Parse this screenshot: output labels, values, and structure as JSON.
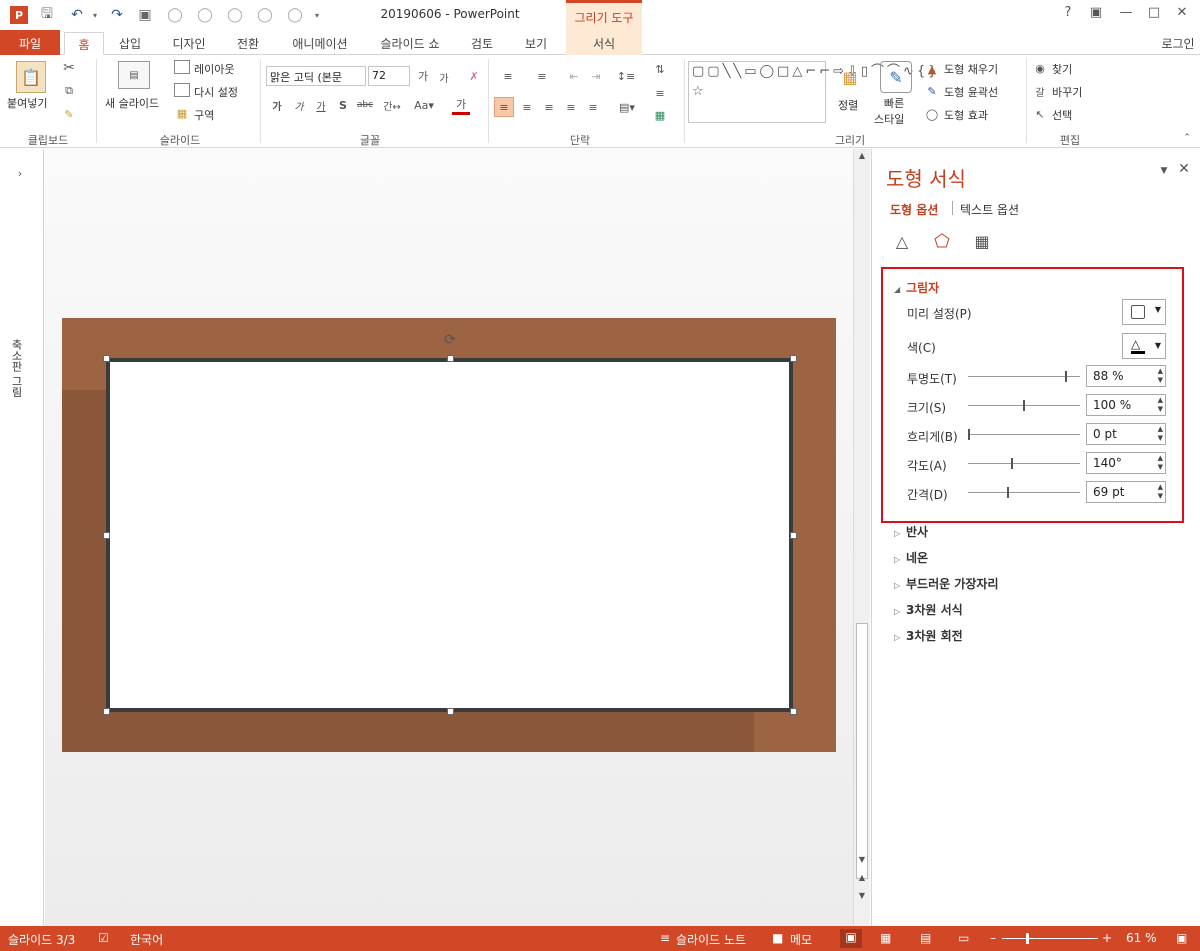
{
  "window": {
    "title": "20190606 - PowerPoint",
    "tools_label": "그리기 도구",
    "help": "?",
    "login": "로그인"
  },
  "tabs": {
    "file": "파일",
    "home": "홈",
    "insert": "삽입",
    "design": "디자인",
    "transitions": "전환",
    "animations": "애니메이션",
    "slideshow": "슬라이드 쇼",
    "review": "검토",
    "view": "보기",
    "format": "서식"
  },
  "ribbon": {
    "clipboard": {
      "label": "클립보드",
      "paste": "붙여넣기"
    },
    "slides": {
      "label": "슬라이드",
      "new_slide": "새 슬라이드",
      "layout": "레이아웃",
      "reset": "다시 설정",
      "section": "구역"
    },
    "font": {
      "label": "글꼴",
      "font_name": "맑은 고딕 (본문",
      "font_size": "72"
    },
    "paragraph": {
      "label": "단락"
    },
    "drawing": {
      "label": "그리기",
      "arrange": "정렬",
      "quick_styles": "빠른",
      "quick_styles2": "스타일",
      "fill": "도형 채우기",
      "outline": "도형 윤곽선",
      "effects": "도형 효과"
    },
    "editing": {
      "label": "편집",
      "find": "찾기",
      "replace": "바꾸기",
      "select": "선택"
    }
  },
  "leftpane": {
    "label": "축소판 그림"
  },
  "format_pane": {
    "title": "도형 서식",
    "tab_shape": "도형 옵션",
    "tab_text": "텍스트 옵션",
    "shadow": {
      "header": "그림자",
      "preset_label": "미리 설정(P)",
      "color_label": "색(C)",
      "transparency": {
        "label": "투명도(T)",
        "value": "88 %",
        "level": 0.88
      },
      "size": {
        "label": "크기(S)",
        "value": "100 %",
        "level": 0.5
      },
      "blur": {
        "label": "흐리게(B)",
        "value": "0 pt",
        "level": 0.0
      },
      "angle": {
        "label": "각도(A)",
        "value": "140°",
        "level": 0.39
      },
      "distance": {
        "label": "간격(D)",
        "value": "69 pt",
        "level": 0.35
      }
    },
    "sections": [
      "반사",
      "네온",
      "부드러운 가장자리",
      "3차원 서식",
      "3차원 회전"
    ]
  },
  "status": {
    "slide": "슬라이드 3/3",
    "language": "한국어",
    "notes": "슬라이드 노트",
    "comments": "메모",
    "zoom": "61 %"
  },
  "colors": {
    "accent": "#d24726",
    "slide_bg": "#9c6442",
    "highlight": "#d9101a"
  }
}
